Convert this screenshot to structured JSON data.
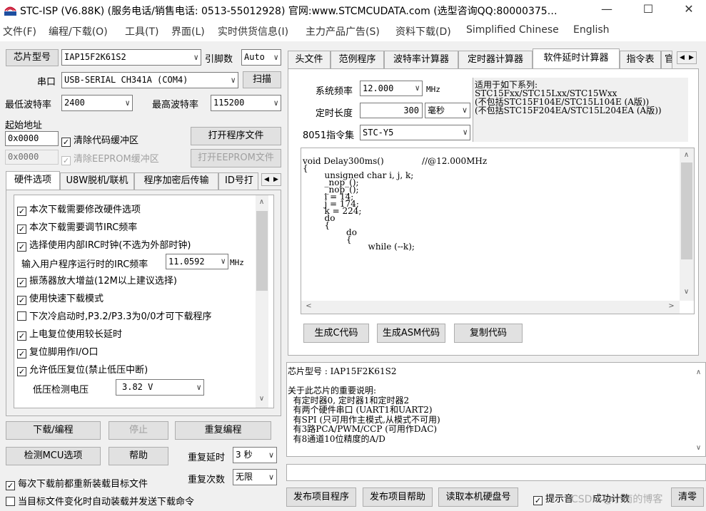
{
  "window": {
    "title": "STC-ISP (V6.88K) (服务电话/销售电话: 0513-55012928) 官网:www.STCMCUDATA.com  (选型咨询QQ:80000375…",
    "minimize": "—",
    "maximize": "☐",
    "close": "✕"
  },
  "menu": [
    "文件(F)",
    "编程/下载(O)",
    "工具(T)",
    "界面(L)",
    "实时供货信息(I)",
    "主力产品广告(S)",
    "资料下载(D)",
    "Simplified Chinese",
    "English"
  ],
  "left": {
    "chip_type_btn": "芯片型号",
    "chip_type_value": "IAP15F2K61S2",
    "pin_label": "引脚数",
    "pin_value": "Auto",
    "port_label": "串口",
    "port_value": "USB-SERIAL CH341A (COM4)",
    "scan_btn": "扫描",
    "min_baud_label": "最低波特率",
    "min_baud_value": "2400",
    "max_baud_label": "最高波特率",
    "max_baud_value": "115200",
    "start_addr_label": "起始地址",
    "code_addr": "0x0000",
    "clear_code_label": "清除代码缓冲区",
    "open_prog_btn": "打开程序文件",
    "eeprom_addr": "0x0000",
    "clear_eeprom_label": "清除EEPROM缓冲区",
    "open_eeprom_btn": "打开EEPROM文件"
  },
  "lefttabs": [
    "硬件选项",
    "U8W脱机/联机",
    "程序加密后传输",
    "ID号打"
  ],
  "hwopts": {
    "items": [
      {
        "label": "本次下载需要修改硬件选项",
        "checked": true
      },
      {
        "label": "本次下载需要调节IRC频率",
        "checked": true
      },
      {
        "label": "选择使用内部IRC时钟(不选为外部时钟)",
        "checked": true
      }
    ],
    "irc_label": "输入用户程序运行时的IRC频率",
    "irc_value": "11.0592",
    "irc_unit": "MHz",
    "items2": [
      {
        "label": "振荡器放大增益(12M以上建议选择)",
        "checked": true
      },
      {
        "label": "使用快速下载模式",
        "checked": true
      },
      {
        "label": "下次冷启动时,P3.2/P3.3为0/0才可下载程序",
        "checked": false
      },
      {
        "label": "上电复位使用较长延时",
        "checked": true
      },
      {
        "label": "复位脚用作I/O口",
        "checked": true
      },
      {
        "label": "允许低压复位(禁止低压中断)",
        "checked": true
      }
    ],
    "lvd_label": "低压检测电压",
    "lvd_value": "3.82 V"
  },
  "bottom_left": {
    "download_btn": "下载/编程",
    "stop_btn": "停止",
    "reprogram_btn": "重复编程",
    "detect_btn": "检测MCU选项",
    "help_btn": "帮助",
    "delay_label": "重复延时",
    "delay_value": "3 秒",
    "count_label": "重复次数",
    "count_value": "无限",
    "reload_label": "每次下载前都重新装载目标文件",
    "auto_label": "当目标文件变化时自动装载并发送下载命令"
  },
  "righttabs": [
    "头文件",
    "范例程序",
    "波特率计算器",
    "定时器计算器",
    "软件延时计算器",
    "指令表",
    "官"
  ],
  "delay": {
    "freq_label": "系统频率",
    "freq_value": "12.000",
    "freq_unit": "MHz",
    "len_label": "定时长度",
    "len_value": "300",
    "len_unit": "毫秒",
    "isa_label": "8051指令集",
    "isa_value": "STC-Y5",
    "series_text": "适用于如下系列:\nSTC15Fxx/STC15Lxx/STC15Wxx\n(不包括STC15F104E/STC15L104E (A版))\n(不包括STC15F204EA/STC15L204EA (A版))",
    "code_lines": [
      "void Delay300ms()              //@12.000MHz",
      "{",
      "",
      "        unsigned char i, j, k;",
      "",
      "",
      "        _nop_();",
      "        _nop_();",
      "        i = 14;",
      "        j = 174;",
      "        k = 224;",
      "        do",
      "        {",
      "",
      "                do",
      "                {",
      "",
      "                        while (--k);"
    ],
    "gen_c_btn": "生成C代码",
    "gen_asm_btn": "生成ASM代码",
    "copy_btn": "复制代码"
  },
  "chipinfo": "芯片型号 : IAP15F2K61S2\n\n关于此芯片的重要说明:\n  有定时器0, 定时器1和定时器2\n  有两个硬件串口 (UART1和UART2)\n  有SPI (只可用作主模式,从模式不可用)\n  有3路PCA/PWM/CCP (可用作DAC)\n  有8通道10位精度的A/D",
  "bottom_right": {
    "publish_prog_btn": "发布项目程序",
    "publish_help_btn": "发布项目帮助",
    "read_disk_btn": "读取本机硬盘号",
    "hint_label": "提示音",
    "success_label": "成功计数",
    "clear_btn": "清零",
    "watermark": "CSDN @小南的博客"
  },
  "colors": {
    "accent_blue": "#0078d7",
    "logo_red": "#c8102e"
  }
}
